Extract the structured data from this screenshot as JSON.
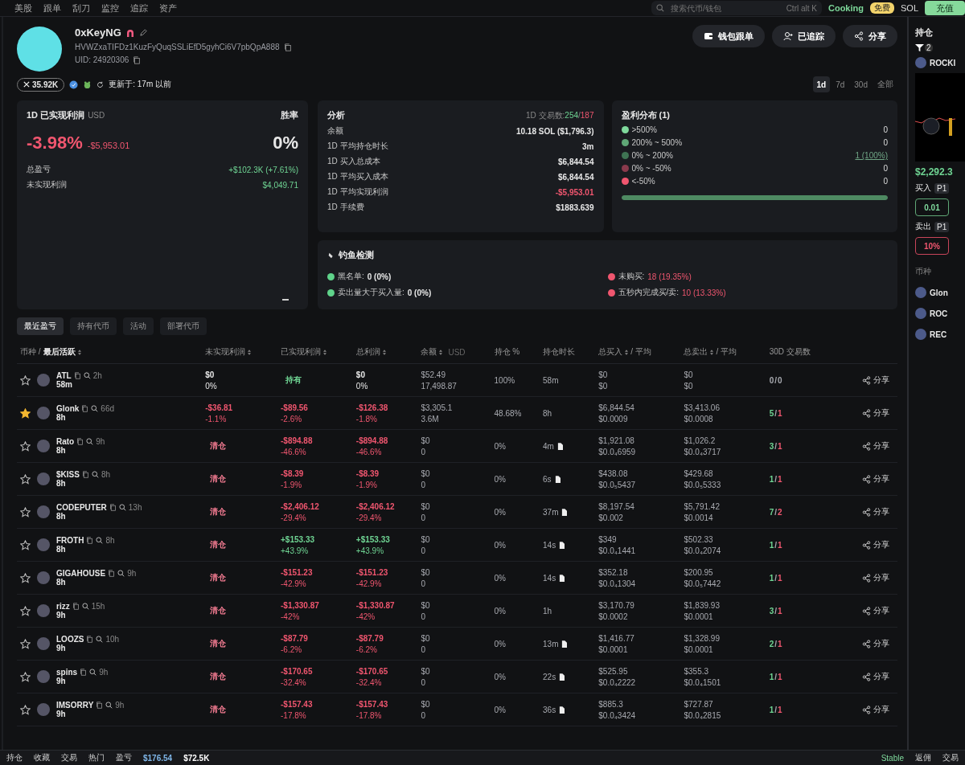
{
  "topnav": {
    "items": [
      "美股",
      "跟单",
      "刮刀",
      "监控",
      "追踪",
      "资产"
    ],
    "search": {
      "placeholder": "搜索代币/钱包",
      "shortcut": "Ctrl alt K"
    },
    "cooking": {
      "label": "Cooking",
      "badge": "免费"
    },
    "chain": "SOL",
    "deposit": "充值"
  },
  "profile": {
    "name": "0xKeyNG",
    "address": "HVWZxaTIFDz1KuzFyQuqSSLiEfD5gyhCi6V7pbQpA888",
    "uid": "UID: 24920306",
    "followers": "35.92K",
    "updated": "更新于: 17m 以前",
    "buttons": [
      {
        "kind": "wallet",
        "label": "钱包跟单"
      },
      {
        "kind": "user",
        "label": "已追踪"
      },
      {
        "kind": "share",
        "label": "分享"
      }
    ],
    "periods": [
      {
        "label": "1d",
        "selected": true
      },
      {
        "label": "7d",
        "selected": false
      },
      {
        "label": "30d",
        "selected": false
      },
      {
        "label": "全部",
        "selected": false
      }
    ]
  },
  "pnl": {
    "title": "1D 已实现利润",
    "currency": "USD",
    "winrate_label": "胜率",
    "percent": "-3.98%",
    "amount": "-$5,953.01",
    "winrate": "0%",
    "rows": [
      {
        "label": "总盈亏",
        "value": "+$102.3K (+7.61%)"
      },
      {
        "label": "未实现利润",
        "value": "$4,049.71"
      }
    ]
  },
  "analysis": {
    "title": "分析",
    "trades_label": "1D 交易数:",
    "buys": "254",
    "separator": "/",
    "sells": "187",
    "rows": [
      {
        "label": "余额",
        "value": "10.18 SOL ($1,796.3)",
        "color": "#e8e8e8"
      },
      {
        "label": "1D 平均持仓时长",
        "value": "3m",
        "color": "#e8e8e8"
      },
      {
        "label": "1D 买入总成本",
        "value": "$6,844.54",
        "color": "#e8e8e8"
      },
      {
        "label": "1D 平均买入成本",
        "value": "$6,844.54",
        "color": "#e8e8e8"
      },
      {
        "label": "1D 平均实现利润",
        "value": "-$5,953.01",
        "color": "#f0566f"
      },
      {
        "label": "1D 手续费",
        "value": "$1883.639",
        "color": "#e8e8e8"
      }
    ]
  },
  "distribution": {
    "title": "盈利分布 (1)",
    "bins": [
      {
        "label": ">500%",
        "value": "0",
        "color": "#7fd99c",
        "highlighted": false
      },
      {
        "label": "200% ~ 500%",
        "value": "0",
        "color": "#5fa776",
        "highlighted": false
      },
      {
        "label": "0% ~ 200%",
        "value": "1 (100%)",
        "color": "#3f7453",
        "highlighted": true
      },
      {
        "label": "0% ~ -50%",
        "value": "0",
        "color": "#8a3a4c",
        "highlighted": false
      },
      {
        "label": "<-50%",
        "value": "0",
        "color": "#f0566f",
        "highlighted": false
      }
    ],
    "bar": {
      "level": 1,
      "color": "#4e8a62"
    }
  },
  "phishing": {
    "title": "钓鱼检测",
    "items": [
      {
        "label": "黑名单:",
        "value": "0 (0%)",
        "color": "#5fd38a",
        "alert": false
      },
      {
        "label": "未购买:",
        "value": "18 (19.35%)",
        "color": "#f0566f",
        "alert": true
      },
      {
        "label": "卖出量大于买入量:",
        "value": "0 (0%)",
        "color": "#5fd38a",
        "alert": false
      },
      {
        "label": "五秒内完成买/卖:",
        "value": "10 (13.33%)",
        "color": "#f0566f",
        "alert": true
      }
    ]
  },
  "tabs": [
    {
      "label": "最近盈亏",
      "selected": true
    },
    {
      "label": "持有代币",
      "selected": false
    },
    {
      "label": "活动",
      "selected": false
    },
    {
      "label": "部署代币",
      "selected": false
    }
  ],
  "table": {
    "columns": [
      {
        "label": "币种 /",
        "strong": "最后活跃",
        "sort": true
      },
      {
        "label": "未实现利润",
        "sort": true
      },
      {
        "label": "已实现利润",
        "sort": true
      },
      {
        "label": "总利润",
        "sort": true
      },
      {
        "label": "余额",
        "sort": true,
        "unit": "USD"
      },
      {
        "label": "持仓 %",
        "sort": false
      },
      {
        "label": "持仓时长",
        "sort": false
      },
      {
        "label": "总买入",
        "sort": true,
        "avg": "/ 平均"
      },
      {
        "label": "总卖出",
        "sort": true,
        "avg": "/ 平均"
      },
      {
        "label": "30D 交易数",
        "sort": false
      }
    ],
    "rows": [
      {
        "token": "ATL",
        "starred": false,
        "age": "2h",
        "active": "58m",
        "unrealized": {
          "kind": "value",
          "color": "#e8e8e8",
          "lines": [
            "$0",
            "0%"
          ]
        },
        "realized": {
          "kind": "tag",
          "color": "#6fd493",
          "text": "持有"
        },
        "total": {
          "kind": "value",
          "color": "#e8e8e8",
          "lines": [
            "$0",
            "0%"
          ]
        },
        "balance": [
          "$52.49",
          "17,498.87"
        ],
        "pct": "100%",
        "hold": "58m",
        "flag": false,
        "buy": [
          "$0",
          "$0"
        ],
        "sell": [
          "$0",
          "$0"
        ],
        "trades": {
          "buys": "0",
          "separator": "/",
          "sells": "0",
          "active": false
        },
        "share": "分享"
      },
      {
        "token": "Glonk",
        "starred": true,
        "age": "66d",
        "active": "8h",
        "unrealized": {
          "kind": "value",
          "color": "#f0566f",
          "lines": [
            "-$36.81",
            "-1.1%"
          ]
        },
        "realized": {
          "kind": "value",
          "color": "#f0566f",
          "lines": [
            "-$89.56",
            "-2.6%"
          ]
        },
        "total": {
          "kind": "value",
          "color": "#f0566f",
          "lines": [
            "-$126.38",
            "-1.8%"
          ]
        },
        "balance": [
          "$3,305.1",
          "3.6M"
        ],
        "pct": "48.68%",
        "hold": "8h",
        "flag": false,
        "buy": [
          "$6,844.54",
          "$0.0009"
        ],
        "sell": [
          "$3,413.06",
          "$0.0008"
        ],
        "trades": {
          "buys": "5",
          "separator": "/",
          "sells": "1",
          "active": true
        },
        "share": "分享"
      },
      {
        "token": "Rato",
        "starred": false,
        "age": "9h",
        "active": "8h",
        "unrealized": {
          "kind": "tag",
          "color": "#f07a90",
          "text": "清仓"
        },
        "realized": {
          "kind": "value",
          "color": "#f0566f",
          "lines": [
            "-$894.88",
            "-46.6%"
          ]
        },
        "total": {
          "kind": "value",
          "color": "#f0566f",
          "lines": [
            "-$894.88",
            "-46.6%"
          ]
        },
        "balance": [
          "$0",
          "0"
        ],
        "pct": "0%",
        "hold": "4m",
        "flag": true,
        "buy": [
          "$1,921.08",
          "$0.0₄6959"
        ],
        "sell": [
          "$1,026.2",
          "$0.0₄3717"
        ],
        "trades": {
          "buys": "3",
          "separator": "/",
          "sells": "1",
          "active": true
        },
        "share": "分享"
      },
      {
        "token": "$KISS",
        "starred": false,
        "age": "8h",
        "active": "8h",
        "unrealized": {
          "kind": "tag",
          "color": "#f07a90",
          "text": "清仓"
        },
        "realized": {
          "kind": "value",
          "color": "#f0566f",
          "lines": [
            "-$8.39",
            "-1.9%"
          ]
        },
        "total": {
          "kind": "value",
          "color": "#f0566f",
          "lines": [
            "-$8.39",
            "-1.9%"
          ]
        },
        "balance": [
          "$0",
          "0"
        ],
        "pct": "0%",
        "hold": "6s",
        "flag": true,
        "buy": [
          "$438.08",
          "$0.0₅5437"
        ],
        "sell": [
          "$429.68",
          "$0.0₅5333"
        ],
        "trades": {
          "buys": "1",
          "separator": "/",
          "sells": "1",
          "active": true
        },
        "share": "分享"
      },
      {
        "token": "CODEPUTER",
        "starred": false,
        "age": "13h",
        "active": "8h",
        "unrealized": {
          "kind": "tag",
          "color": "#f07a90",
          "text": "清仓"
        },
        "realized": {
          "kind": "value",
          "color": "#f0566f",
          "lines": [
            "-$2,406.12",
            "-29.4%"
          ]
        },
        "total": {
          "kind": "value",
          "color": "#f0566f",
          "lines": [
            "-$2,406.12",
            "-29.4%"
          ]
        },
        "balance": [
          "$0",
          "0"
        ],
        "pct": "0%",
        "hold": "37m",
        "flag": true,
        "buy": [
          "$8,197.54",
          "$0.002"
        ],
        "sell": [
          "$5,791.42",
          "$0.0014"
        ],
        "trades": {
          "buys": "7",
          "separator": "/",
          "sells": "2",
          "active": true
        },
        "share": "分享"
      },
      {
        "token": "FROTH",
        "starred": false,
        "age": "8h",
        "active": "8h",
        "unrealized": {
          "kind": "tag",
          "color": "#f07a90",
          "text": "清仓"
        },
        "realized": {
          "kind": "value",
          "color": "#6fd493",
          "lines": [
            "+$153.33",
            "+43.9%"
          ]
        },
        "total": {
          "kind": "value",
          "color": "#6fd493",
          "lines": [
            "+$153.33",
            "+43.9%"
          ]
        },
        "balance": [
          "$0",
          "0"
        ],
        "pct": "0%",
        "hold": "14s",
        "flag": true,
        "buy": [
          "$349",
          "$0.0₄1441"
        ],
        "sell": [
          "$502.33",
          "$0.0₄2074"
        ],
        "trades": {
          "buys": "1",
          "separator": "/",
          "sells": "1",
          "active": true
        },
        "share": "分享"
      },
      {
        "token": "GIGAHOUSE",
        "starred": false,
        "age": "9h",
        "active": "8h",
        "unrealized": {
          "kind": "tag",
          "color": "#f07a90",
          "text": "清仓"
        },
        "realized": {
          "kind": "value",
          "color": "#f0566f",
          "lines": [
            "-$151.23",
            "-42.9%"
          ]
        },
        "total": {
          "kind": "value",
          "color": "#f0566f",
          "lines": [
            "-$151.23",
            "-42.9%"
          ]
        },
        "balance": [
          "$0",
          "0"
        ],
        "pct": "0%",
        "hold": "14s",
        "flag": true,
        "buy": [
          "$352.18",
          "$0.0₄1304"
        ],
        "sell": [
          "$200.95",
          "$0.0₅7442"
        ],
        "trades": {
          "buys": "1",
          "separator": "/",
          "sells": "1",
          "active": true
        },
        "share": "分享"
      },
      {
        "token": "rizz",
        "starred": false,
        "age": "15h",
        "active": "9h",
        "unrealized": {
          "kind": "tag",
          "color": "#f07a90",
          "text": "清仓"
        },
        "realized": {
          "kind": "value",
          "color": "#f0566f",
          "lines": [
            "-$1,330.87",
            "-42%"
          ]
        },
        "total": {
          "kind": "value",
          "color": "#f0566f",
          "lines": [
            "-$1,330.87",
            "-42%"
          ]
        },
        "balance": [
          "$0",
          "0"
        ],
        "pct": "0%",
        "hold": "1h",
        "flag": false,
        "buy": [
          "$3,170.79",
          "$0.0002"
        ],
        "sell": [
          "$1,839.93",
          "$0.0001"
        ],
        "trades": {
          "buys": "3",
          "separator": "/",
          "sells": "1",
          "active": true
        },
        "share": "分享"
      },
      {
        "token": "LOOZS",
        "starred": false,
        "age": "10h",
        "active": "9h",
        "unrealized": {
          "kind": "tag",
          "color": "#f07a90",
          "text": "清仓"
        },
        "realized": {
          "kind": "value",
          "color": "#f0566f",
          "lines": [
            "-$87.79",
            "-6.2%"
          ]
        },
        "total": {
          "kind": "value",
          "color": "#f0566f",
          "lines": [
            "-$87.79",
            "-6.2%"
          ]
        },
        "balance": [
          "$0",
          "0"
        ],
        "pct": "0%",
        "hold": "13m",
        "flag": true,
        "buy": [
          "$1,416.77",
          "$0.0001"
        ],
        "sell": [
          "$1,328.99",
          "$0.0001"
        ],
        "trades": {
          "buys": "2",
          "separator": "/",
          "sells": "1",
          "active": true
        },
        "share": "分享"
      },
      {
        "token": "spins",
        "starred": false,
        "age": "9h",
        "active": "9h",
        "unrealized": {
          "kind": "tag",
          "color": "#f07a90",
          "text": "清仓"
        },
        "realized": {
          "kind": "value",
          "color": "#f0566f",
          "lines": [
            "-$170.65",
            "-32.4%"
          ]
        },
        "total": {
          "kind": "value",
          "color": "#f0566f",
          "lines": [
            "-$170.65",
            "-32.4%"
          ]
        },
        "balance": [
          "$0",
          "0"
        ],
        "pct": "0%",
        "hold": "22s",
        "flag": true,
        "buy": [
          "$525.95",
          "$0.0₄2222"
        ],
        "sell": [
          "$355.3",
          "$0.0₄1501"
        ],
        "trades": {
          "buys": "1",
          "separator": "/",
          "sells": "1",
          "active": true
        },
        "share": "分享"
      },
      {
        "token": "IMSORRY",
        "starred": false,
        "age": "9h",
        "active": "9h",
        "unrealized": {
          "kind": "tag",
          "color": "#f07a90",
          "text": "清仓"
        },
        "realized": {
          "kind": "value",
          "color": "#f0566f",
          "lines": [
            "-$157.43",
            "-17.8%"
          ]
        },
        "total": {
          "kind": "value",
          "color": "#f0566f",
          "lines": [
            "-$157.43",
            "-17.8%"
          ]
        },
        "balance": [
          "$0",
          "0"
        ],
        "pct": "0%",
        "hold": "36s",
        "flag": true,
        "buy": [
          "$885.3",
          "$0.0₄3424"
        ],
        "sell": [
          "$727.87",
          "$0.0₄2815"
        ],
        "trades": {
          "buys": "1",
          "separator": "/",
          "sells": "1",
          "active": true
        },
        "share": "分享"
      }
    ]
  },
  "sidebar": {
    "title": "持仓",
    "filter_count": "2",
    "token": "ROCKI",
    "price": "$2,292.3",
    "buy_label": "买入",
    "buy_preset": "P1",
    "buy_amount": "0.01",
    "sell_label": "卖出",
    "sell_preset": "P1",
    "sell_amount": "10%",
    "list_title": "币种",
    "list": [
      "Glon",
      "ROC",
      "REC"
    ]
  },
  "bottombar": {
    "items": [
      "持仓",
      "收藏",
      "交易",
      "热门",
      "盈亏"
    ],
    "balances": [
      "$176.54",
      "$72.5K"
    ],
    "right": [
      "Stable",
      "返佣",
      "交易"
    ]
  }
}
